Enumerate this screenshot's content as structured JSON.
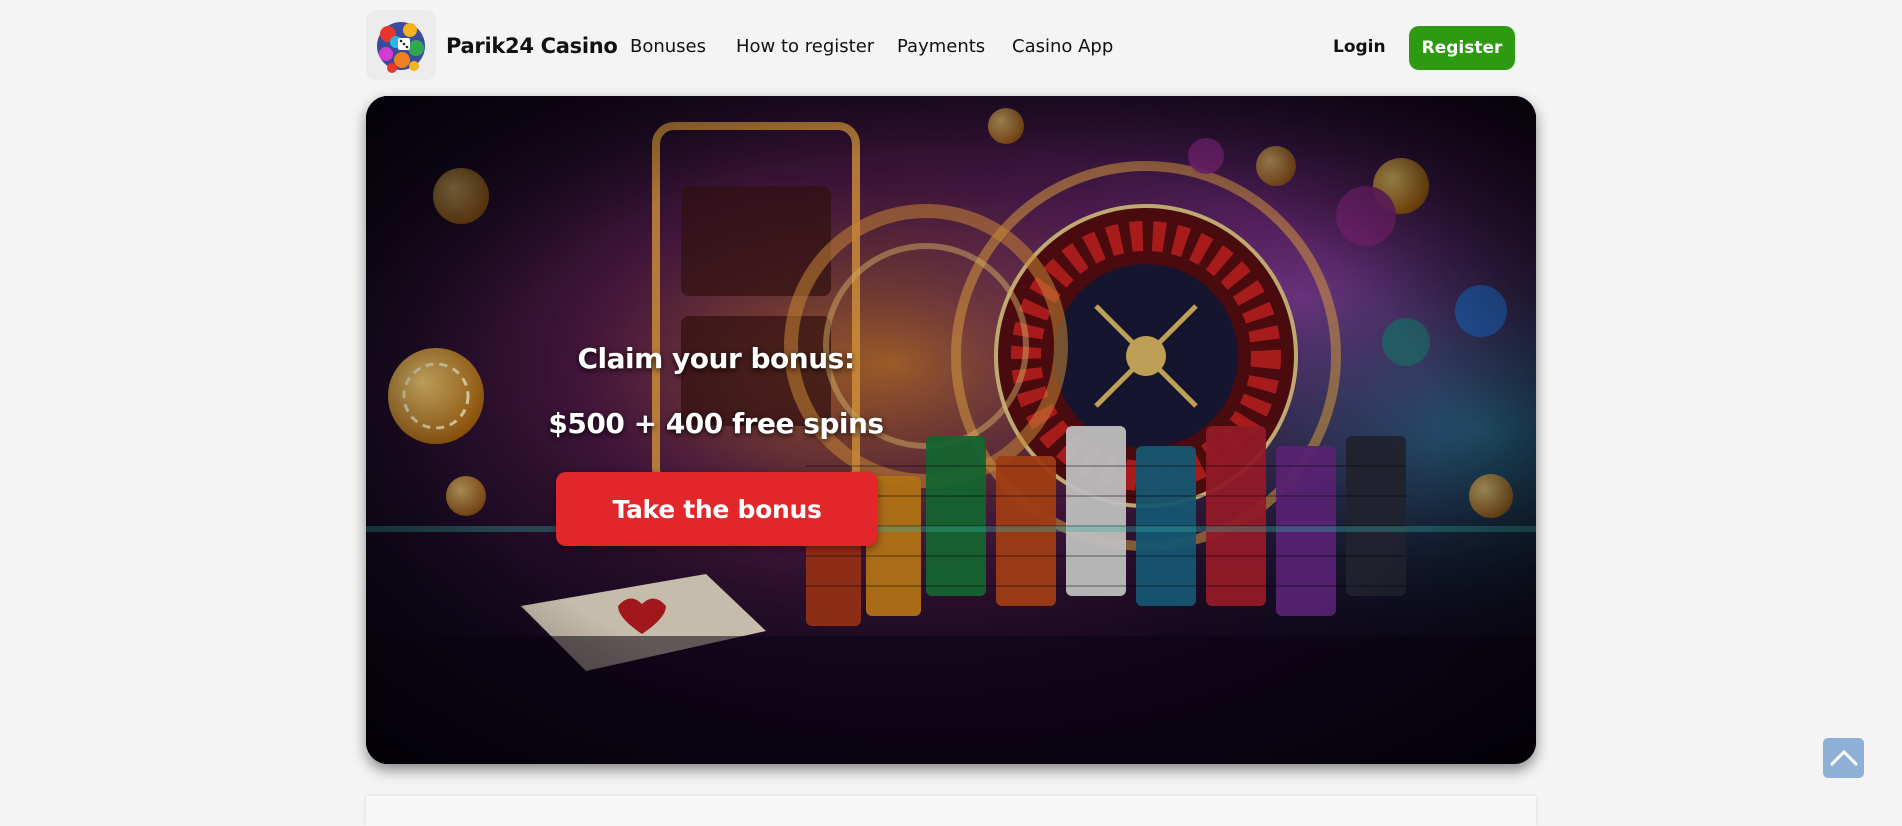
{
  "header": {
    "logo_icon": "casino-dice-chips-logo",
    "brand": "Parik24 Casino",
    "nav": [
      {
        "label": "Bonuses"
      },
      {
        "label": "How to register"
      },
      {
        "label": "Payments"
      },
      {
        "label": "Casino App"
      }
    ],
    "login_label": "Login",
    "register_label": "Register"
  },
  "hero": {
    "title": "Claim your bonus:",
    "offer": "$500 + 400 free spins",
    "cta_label": "Take the bonus"
  },
  "scroll_top": {
    "icon": "chevron-up-icon"
  },
  "colors": {
    "register": "#2e9a12",
    "cta": "#e3262a",
    "scroll_top": "#8fb0d6",
    "background": "#f4f4f4"
  }
}
